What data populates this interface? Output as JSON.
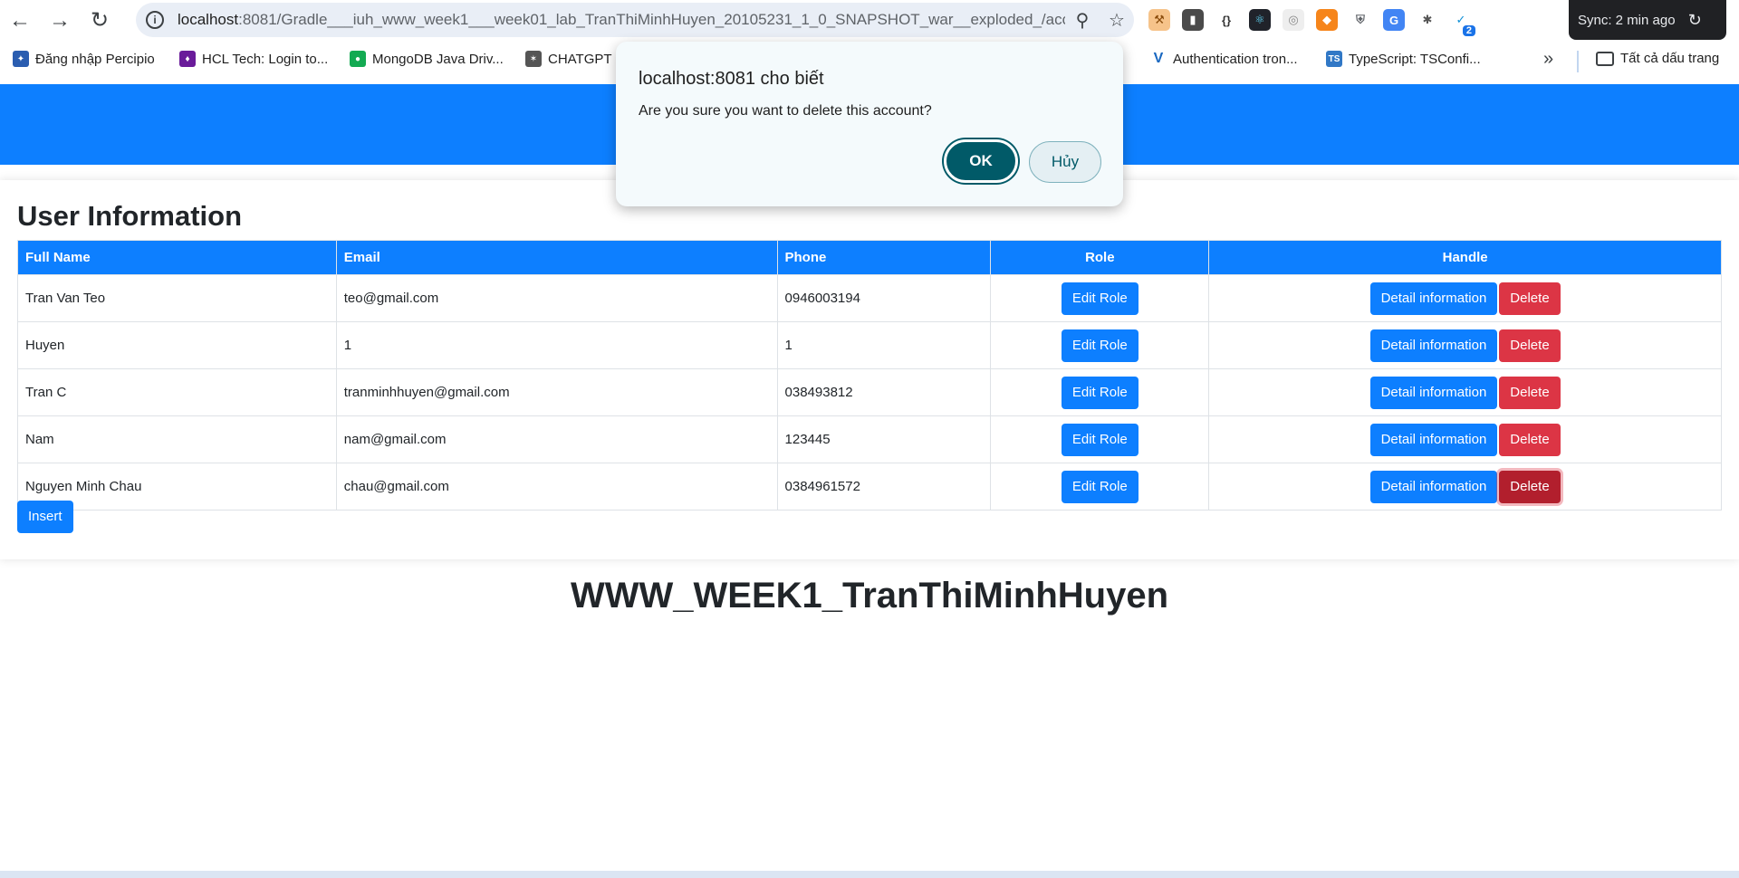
{
  "browser": {
    "url_host": "localhost",
    "url_path": ":8081/Gradle___iuh_www_week1___week01_lab_TranThiMinhHuyen_20105231_1_0_SNAPSHOT_war__exploded_/acc...",
    "sync_label": "Sync: 2 min ago",
    "extension_badge": "2",
    "bookmarks": [
      {
        "label": "Đăng nhập Percipio",
        "icon": "percipio-icon",
        "color": "#2a5db0"
      },
      {
        "label": "HCL Tech: Login to...",
        "icon": "hcl-icon",
        "color": "#6a1b9a"
      },
      {
        "label": "MongoDB Java Driv...",
        "icon": "mongodb-icon",
        "color": "#13aa52"
      },
      {
        "label": "CHATGPT",
        "icon": "chatgpt-icon",
        "color": "#555555"
      },
      {
        "label": "Authentication tron...",
        "icon": "vuetify-icon",
        "color": "#1867c0"
      },
      {
        "label": "TypeScript: TSConfi...",
        "icon": "typescript-icon",
        "color": "#3178c6"
      }
    ],
    "all_bookmarks_label": "Tất cả dấu trang"
  },
  "page": {
    "card_title": "User Information",
    "columns": [
      "Full Name",
      "Email",
      "Phone",
      "Role",
      "Handle"
    ],
    "rows": [
      {
        "name": "Tran Van Teo",
        "email": "teo@gmail.com",
        "phone": "0946003194"
      },
      {
        "name": "Huyen",
        "email": "1",
        "phone": "1"
      },
      {
        "name": "Tran C",
        "email": "tranminhhuyen@gmail.com",
        "phone": "038493812"
      },
      {
        "name": "Nam",
        "email": "nam@gmail.com",
        "phone": "123445"
      },
      {
        "name": "Nguyen Minh Chau",
        "email": "chau@gmail.com",
        "phone": "0384961572"
      }
    ],
    "edit_role_label": "Edit Role",
    "detail_label": "Detail information",
    "delete_label": "Delete",
    "insert_label": "Insert",
    "footer_title": "WWW_WEEK1_TranThiMinhHuyen",
    "colors": {
      "primary": "#0d7fff",
      "danger": "#dc3545"
    }
  },
  "dialog": {
    "title": "localhost:8081 cho biết",
    "message": "Are you sure you want to delete this account?",
    "ok_label": "OK",
    "cancel_label": "Hủy"
  }
}
